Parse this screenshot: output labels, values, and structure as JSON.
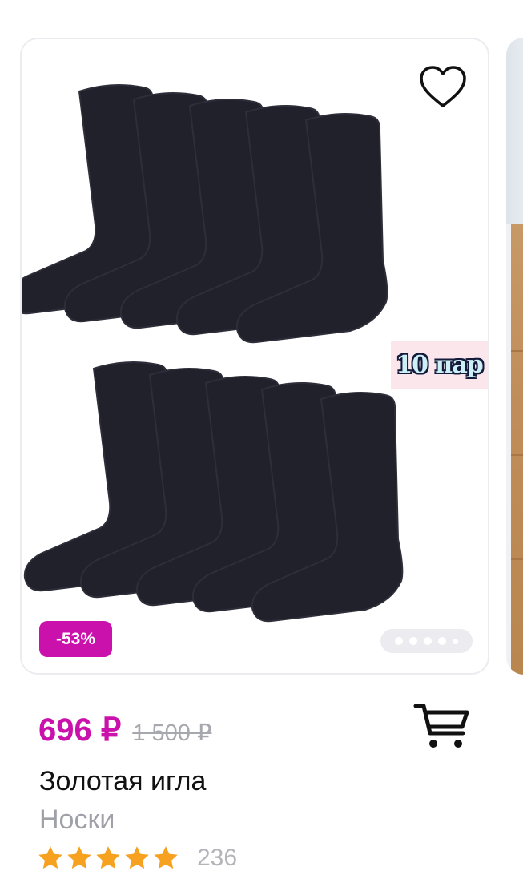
{
  "product": {
    "pack_label": "10 пар",
    "discount": "-53%",
    "image_count": 5,
    "active_image": 1
  },
  "price": {
    "current": "696 ₽",
    "old": "1 500 ₽"
  },
  "brand": "Золотая игла",
  "category": "Носки",
  "rating": {
    "stars": 5,
    "reviews_count": "236"
  },
  "icons": {
    "favorite": "heart-outline-icon",
    "cart": "shopping-cart-icon",
    "star": "star-icon"
  },
  "colors": {
    "accent": "#cb11ab",
    "star": "#f6a11f",
    "muted": "#a7a7ae",
    "text": "#111111"
  }
}
